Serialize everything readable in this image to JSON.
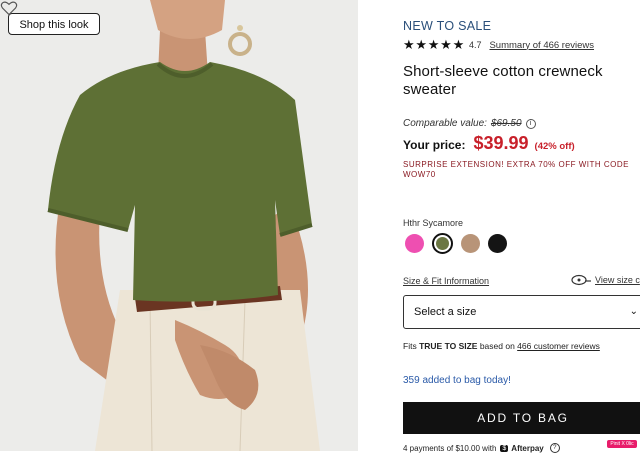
{
  "image_panel": {
    "shop_look_label": "Shop this look",
    "favorite_icon": "heart-outline-icon",
    "colors": {
      "sweater": "#5e7035",
      "background": "#ececea",
      "pants": "#ede5d6",
      "skin": "#c99474",
      "belt": "#6a3522"
    }
  },
  "product": {
    "badge": "NEW TO SALE",
    "rating": "4.7",
    "reviews_link": "Summary of 466 reviews",
    "title": "Short-sleeve cotton crewneck sweater",
    "comparable_label": "Comparable value:",
    "comparable_price": "$69.50",
    "your_price_label": "Your price:",
    "price": "$39.99",
    "discount": "(42% off)",
    "promo": "SURPRISE EXTENSION! EXTRA 70% OFF WITH CODE WOW70",
    "color_name": "Hthr Sycamore",
    "swatches": [
      {
        "name": "pink",
        "color": "#ee4fb1"
      },
      {
        "name": "hthr-sycamore",
        "color": "#6b7743",
        "selected": true
      },
      {
        "name": "tan",
        "color": "#b89478"
      },
      {
        "name": "black",
        "color": "#141414"
      }
    ],
    "size_fit_link": "Size & Fit Information",
    "view_size_link": "View size c",
    "select_placeholder": "Select a size",
    "fits_prefix": "Fits ",
    "fits_bold": "TRUE TO SIZE",
    "fits_mid": " based on ",
    "fits_link": "466 customer reviews",
    "added_text": "359 added to bag today!",
    "add_button": "ADD TO BAG",
    "afterpay_text": "4 payments of $10.00 with",
    "afterpay_brand": "Afterpay",
    "pinterest_label": "Pinit X 0lic"
  },
  "accent": {
    "price_red": "#c8202a",
    "link_blue": "#2a5aa8",
    "badge_blue": "#2a4f7a"
  }
}
